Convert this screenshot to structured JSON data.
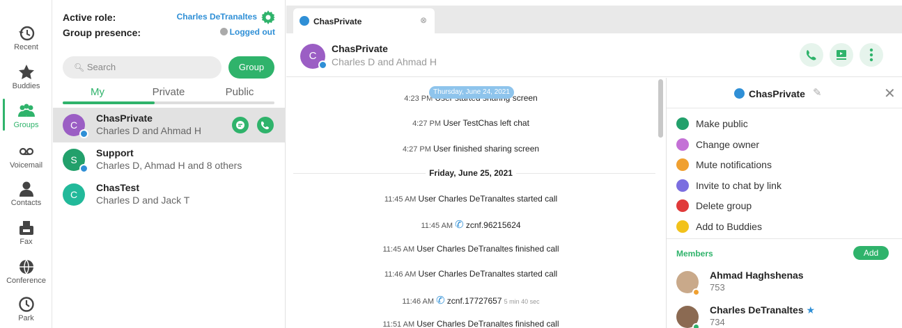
{
  "nav": {
    "items": [
      {
        "label": "Recent",
        "icon": "history-icon"
      },
      {
        "label": "Buddies",
        "icon": "star-icon"
      },
      {
        "label": "Groups",
        "icon": "group-icon"
      },
      {
        "label": "Voicemail",
        "icon": "voicemail-icon"
      },
      {
        "label": "Contacts",
        "icon": "person-icon"
      },
      {
        "label": "Fax",
        "icon": "fax-icon"
      },
      {
        "label": "Conference",
        "icon": "globe-icon"
      },
      {
        "label": "Park",
        "icon": "clock-icon"
      }
    ],
    "active": "Groups"
  },
  "groups_panel": {
    "active_role_label": "Active role:",
    "active_role_value": "Charles DeTranaltes",
    "presence_label": "Group presence:",
    "presence_value": "Logged out",
    "search_placeholder": "Search",
    "group_button": "Group",
    "tabs": [
      "My",
      "Private",
      "Public"
    ],
    "active_tab": "My",
    "list": [
      {
        "initial": "C",
        "name": "ChasPrivate",
        "members": "Charles D and Ahmad H",
        "selected": true,
        "avatar_color": "#9b5ec4",
        "locked": true
      },
      {
        "initial": "S",
        "name": "Support",
        "members": "Charles D, Ahmad H and 8 others",
        "selected": false,
        "avatar_color": "#22a06b",
        "locked": true
      },
      {
        "initial": "C",
        "name": "ChasTest",
        "members": "Charles D and Jack T",
        "selected": false,
        "avatar_color": "#22b99a",
        "locked": false
      }
    ]
  },
  "chat": {
    "tab_title": "ChasPrivate",
    "header_title": "ChasPrivate",
    "header_subtitle": "Charles D and Ahmad H",
    "header_initial": "C",
    "date_pill": "Thursday, June 24, 2021",
    "messages_day1": [
      {
        "time": "4:23 PM",
        "text": "User  started sharing screen"
      },
      {
        "time": "4:27 PM",
        "text": "User TestChas left chat"
      },
      {
        "time": "4:27 PM",
        "text": "User  finished sharing screen"
      }
    ],
    "day2_label": "Friday, June 25, 2021",
    "messages_day2": [
      {
        "time": "11:45 AM",
        "text": "User Charles DeTranaltes started call",
        "call": false,
        "duration": ""
      },
      {
        "time": "11:45 AM",
        "text": "zcnf.96215624",
        "call": true,
        "duration": ""
      },
      {
        "time": "11:45 AM",
        "text": "User Charles DeTranaltes finished call",
        "call": false,
        "duration": ""
      },
      {
        "time": "11:46 AM",
        "text": "User Charles DeTranaltes started call",
        "call": false,
        "duration": ""
      },
      {
        "time": "11:46 AM",
        "text": "zcnf.17727657",
        "call": true,
        "duration": "5 min 40 sec"
      },
      {
        "time": "11:51 AM",
        "text": "User Charles DeTranaltes finished call",
        "call": false,
        "duration": ""
      }
    ]
  },
  "details": {
    "title": "ChasPrivate",
    "actions": [
      {
        "label": "Make public",
        "color": "#22a06b",
        "icon": "lock-icon"
      },
      {
        "label": "Change owner",
        "color": "#c471d6",
        "icon": "owner-icon"
      },
      {
        "label": "Mute notifications",
        "color": "#f0a030",
        "icon": "mute-icon"
      },
      {
        "label": "Invite to chat by link",
        "color": "#7b6ee0",
        "icon": "link-icon"
      },
      {
        "label": "Delete group",
        "color": "#e03a3a",
        "icon": "trash-icon"
      },
      {
        "label": "Add to Buddies",
        "color": "#f2c21b",
        "icon": "star-icon"
      }
    ],
    "members_label": "Members",
    "add_button": "Add",
    "members": [
      {
        "name": "Ahmad Haghshenas",
        "ext": "753",
        "status_color": "#f0a030",
        "starred": false
      },
      {
        "name": "Charles DeTranaltes",
        "ext": "734",
        "status_color": "#2fb36b",
        "starred": true
      }
    ]
  },
  "colors": {
    "accent": "#2fb36b",
    "link": "#2f8fd6"
  }
}
